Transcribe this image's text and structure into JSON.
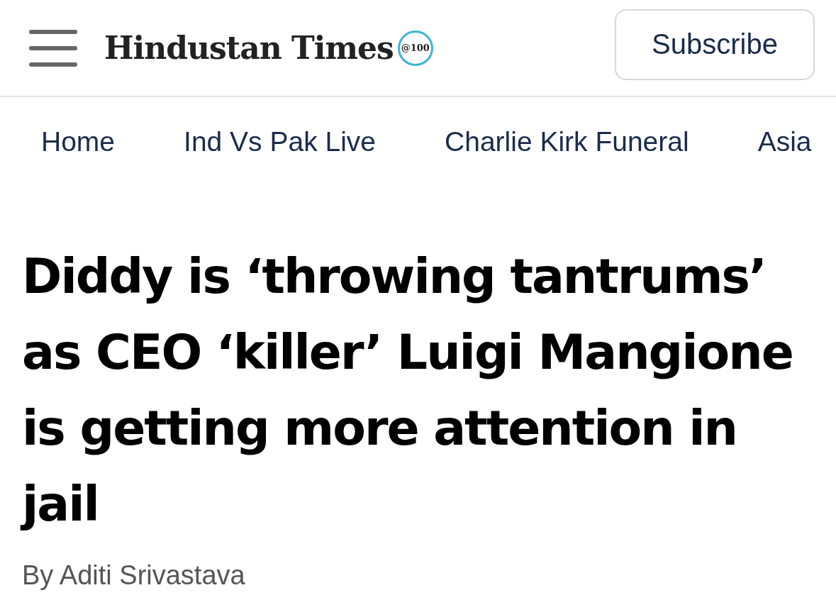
{
  "header": {
    "logo": "Hindustan Times",
    "badge": "@100",
    "subscribe_button": "Subscribe"
  },
  "nav": [
    {
      "label": "Home"
    },
    {
      "label": "Ind Vs Pak Live"
    },
    {
      "label": "Charlie Kirk Funeral"
    },
    {
      "label": "Asia"
    }
  ],
  "article": {
    "headline": "Diddy is ‘throwing tantrums’ as CEO ‘killer’ Luigi Mangione is getting more attention in jail",
    "byline": "By Aditi Srivastava"
  }
}
